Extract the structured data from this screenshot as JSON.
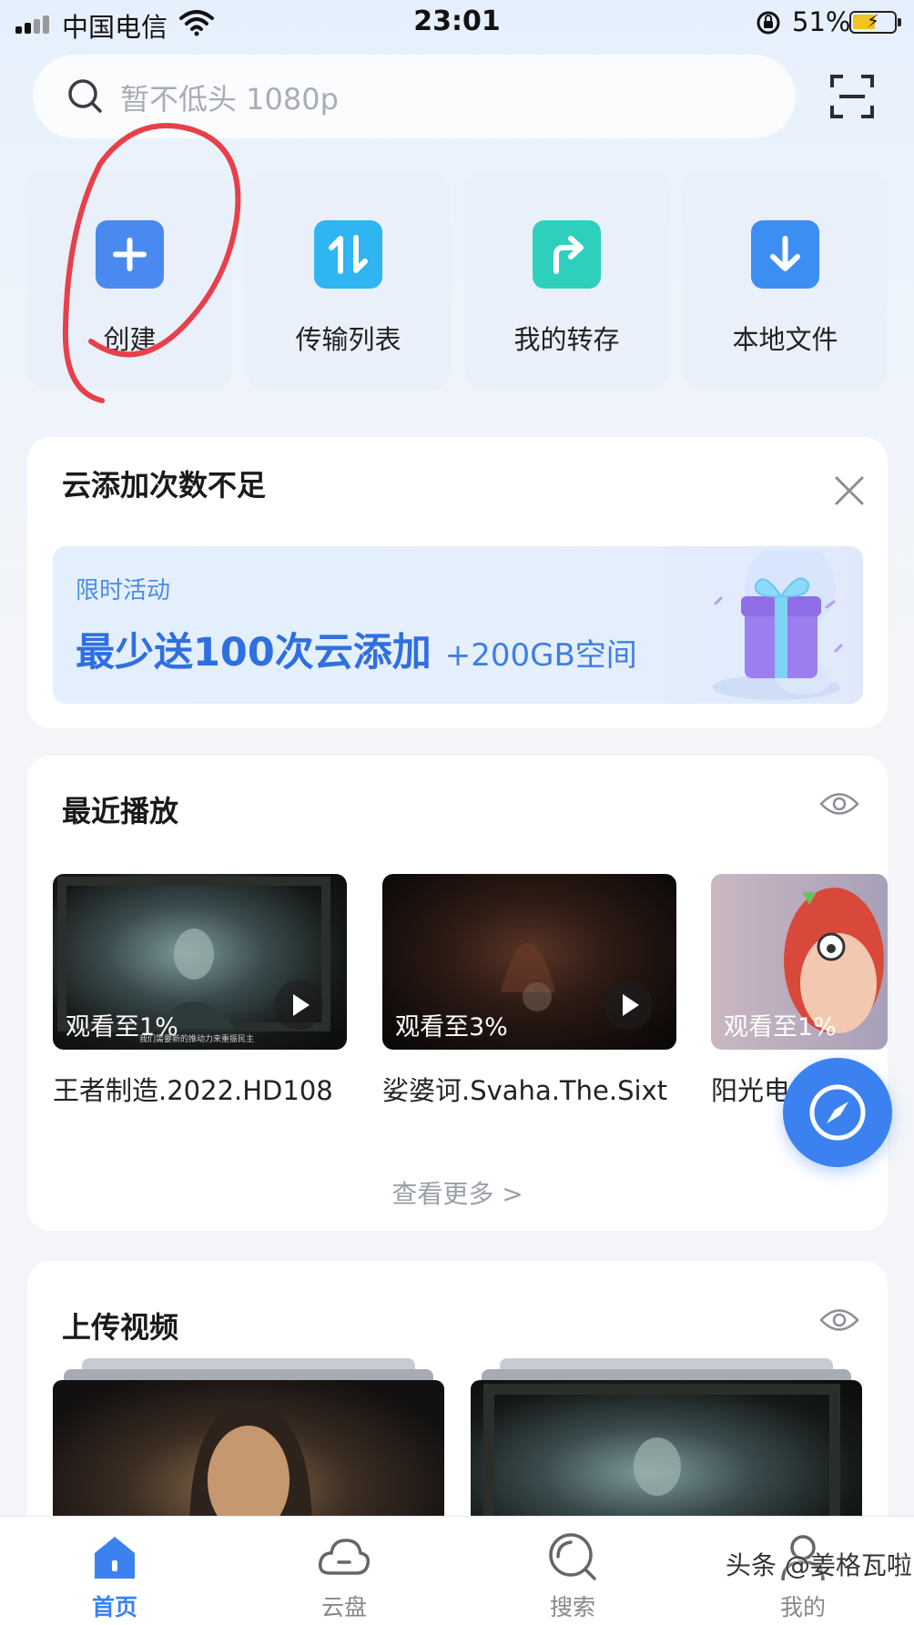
{
  "status_bar": {
    "carrier": "中国电信",
    "time": "23:01",
    "battery_percent": "51%"
  },
  "search": {
    "placeholder": "暂不低头 1080p",
    "icon": "search-icon",
    "scan_icon": "scan-icon"
  },
  "quick_actions": [
    {
      "label": "创建",
      "icon": "plus-icon",
      "color": "#4a8af0"
    },
    {
      "label": "传输列表",
      "icon": "transfer-icon",
      "color": "#2fb5f2"
    },
    {
      "label": "我的转存",
      "icon": "forward-arrow-icon",
      "color": "#2fcfbe"
    },
    {
      "label": "本地文件",
      "icon": "download-icon",
      "color": "#3d8ef2"
    }
  ],
  "promo": {
    "title": "云添加次数不足",
    "tag": "限时活动",
    "headline": "最少送100次云添加",
    "headline_extra": "+200GB空间"
  },
  "recent": {
    "title": "最近播放",
    "items": [
      {
        "progress": "观看至1%",
        "title": "王者制造.2022.HD108",
        "subtitle": "我们需要新的推动力来重振民主"
      },
      {
        "progress": "观看至3%",
        "title": "娑婆诃.Svaha.The.Sixt"
      },
      {
        "progress": "观看至1%",
        "title": "阳光电"
      }
    ],
    "see_more": "查看更多 >"
  },
  "upload": {
    "title": "上传视频"
  },
  "tabbar": [
    {
      "label": "首页",
      "icon": "home-icon",
      "active": true
    },
    {
      "label": "云盘",
      "icon": "cloud-icon",
      "active": false
    },
    {
      "label": "搜索",
      "icon": "search-tab-icon",
      "active": false
    },
    {
      "label": "我的",
      "icon": "profile-icon",
      "active": false
    }
  ],
  "watermark": "头条 @姜格瓦啦",
  "colors": {
    "accent": "#3b82f0",
    "annotation": "#e8404b"
  }
}
